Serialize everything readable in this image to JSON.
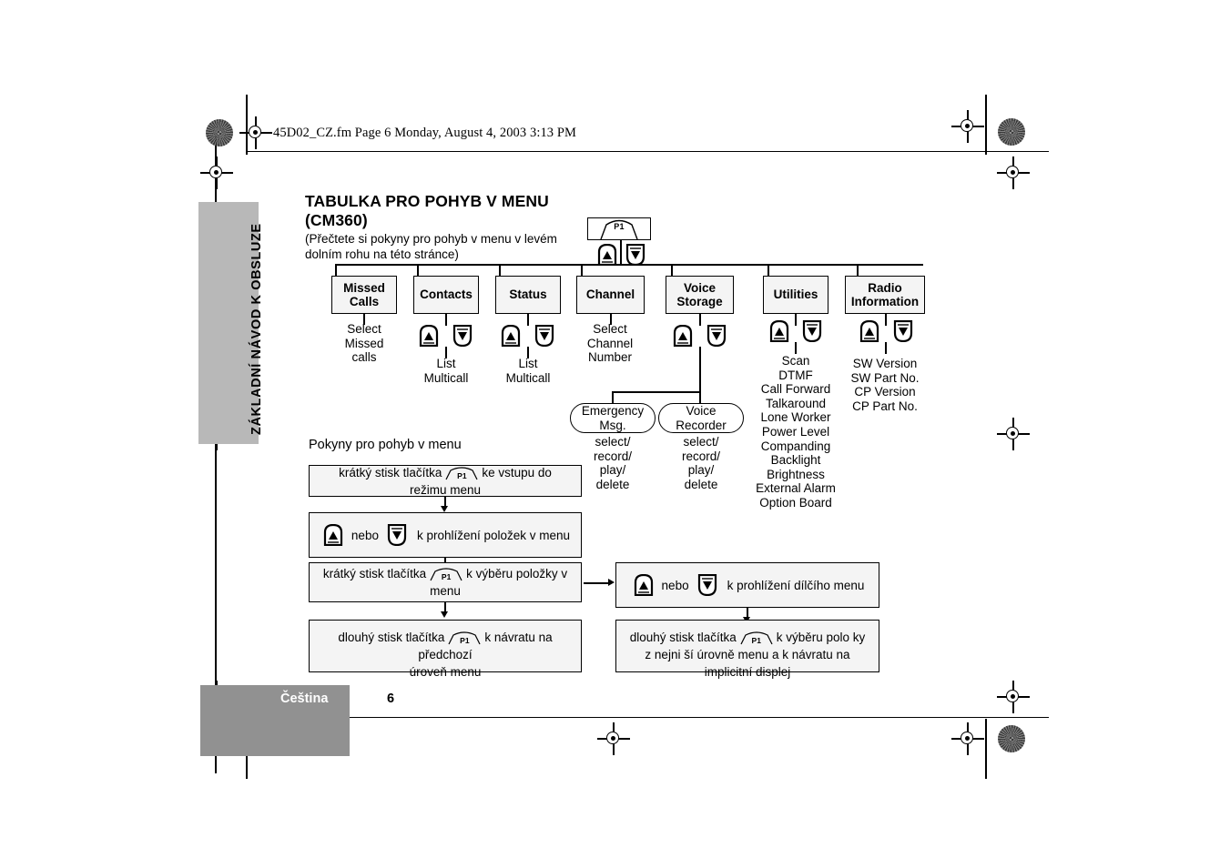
{
  "header": {
    "file_stamp": "45D02_CZ.fm  Page 6  Monday, August 4, 2003  3:13 PM"
  },
  "side_tab": {
    "label": "ZÁKLADNÍ NÁVOD K OBSLUZE"
  },
  "title": {
    "main": "TABULKA PRO POHYB V MENU\n(CM360)",
    "subtitle": "(Přečtete si pokyny pro pohyb v menu v levém\ndolním rohu na této stránce)"
  },
  "menu_tree": {
    "root_key": {
      "label": "P1",
      "icon": "p1-key-icon"
    },
    "root_arrows": {
      "up": "up-arrow-icon",
      "down": "down-arrow-icon"
    },
    "nodes": [
      {
        "label": "Missed\nCalls",
        "has_arrows": false,
        "caption": "Select\nMissed\ncalls"
      },
      {
        "label": "Contacts",
        "has_arrows": true,
        "caption": "List\nMulticall"
      },
      {
        "label": "Status",
        "has_arrows": true,
        "caption": "List\nMulticall"
      },
      {
        "label": "Channel",
        "has_arrows": false,
        "caption": "Select\nChannel\nNumber"
      },
      {
        "label": "Voice\nStorage",
        "has_arrows": true,
        "caption": ""
      },
      {
        "label": "Utilities",
        "has_arrows": true,
        "caption": "Scan\nDTMF\nCall Forward\nTalkaround\nLone Worker\nPower Level\nCompanding\nBacklight\nBrightness\nExternal Alarm\nOption Board"
      },
      {
        "label": "Radio\nInformation",
        "has_arrows": true,
        "caption": "SW Version\nSW Part No.\nCP Version\nCP Part No."
      }
    ],
    "voice_storage_children": [
      {
        "label": "Emergency\nMsg.",
        "caption": "select/\nrecord/\nplay/\ndelete"
      },
      {
        "label": "Voice\nRecorder",
        "caption": "select/\nrecord/\nplay/\ndelete"
      }
    ]
  },
  "instructions": {
    "heading": "Pokyny pro pohyb v menu",
    "left": [
      {
        "pre": "krátký stisk tlačítka",
        "key": "P1",
        "post": "ke vstupu do režimu menu"
      },
      {
        "pre": "",
        "keys": [
          "up",
          "down"
        ],
        "mid": "nebo",
        "post": "k prohlížení položek v menu"
      },
      {
        "pre": "krátký stisk tlačítka",
        "key": "P1",
        "post": "k výběru položky v menu"
      },
      {
        "pre": "dlouhý stisk tlačítka",
        "key": "P1",
        "post": "k návratu na předchozí\núroveň menu"
      }
    ],
    "right": [
      {
        "pre": "",
        "keys": [
          "up",
          "down"
        ],
        "mid": "nebo",
        "post": "k prohlížení dílčího menu"
      },
      {
        "pre": "dlouhý stisk tlačítka",
        "key": "P1",
        "post": "k výběru polo ky\nz nejni ší úrovně menu a k návratu na\nimplicitní displej"
      }
    ]
  },
  "footer": {
    "language": "Čeština",
    "page_number": "6"
  }
}
